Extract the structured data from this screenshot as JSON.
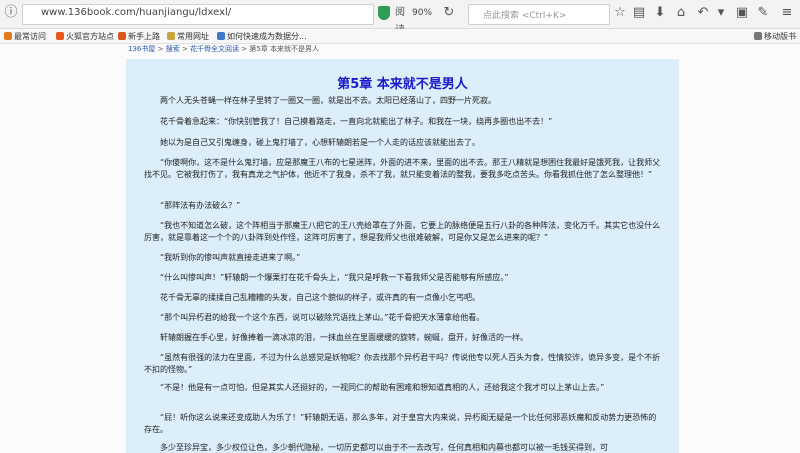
{
  "browser": {
    "url": "www.136book.com/huanjiangu/ldxexl/",
    "zoom": "90%",
    "search_placeholder": "点此搜索 <Ctrl+K>",
    "reader_label": "阅读"
  },
  "bookmarks": {
    "items": [
      "最常访问",
      "火狐官方站点",
      "新手上路",
      "常用网址",
      "如何快速成为数据分..."
    ],
    "mobile": "移动版书"
  },
  "breadcrumb": {
    "items": [
      "136书屋",
      "搜索",
      "花千骨全文阅读",
      "第5章 本来就不是男人"
    ]
  },
  "chapter": {
    "title": "第5章 本来就不是男人",
    "paragraphs": [
      "两个人无头苍蝇一样在林子里转了一圈又一圈，就是出不去。太阳已经落山了，四野一片死寂。",
      "花千骨着急起来：“你快别管我了！自己摸着路走，一直向北就能出了林子。和我在一块，绕再多圈也出不去！”",
      "她以为是自己又引鬼缠身，碰上鬼打墙了，心想轩辕朗若是一个人走的话应该就能出去了。",
      "“你傻啊你，这不是什么鬼打墙，应是那魔王八布的七星迷阵，外面的进不来，里面的出不去。那王八精就是想困住我最好是饿死我，让我师父找不见。它被我打伤了，我有真龙之气护体，他近不了我身，杀不了我，就只能变着法的整我，要我多吃点苦头。你看我抓住他了怎么整理他！”",
      "“那阵法有办法破么？”",
      "“我也不知道怎么破，这个阵相当于那魔王八把它的王八壳给罩在了外面，它要上的脉络便是五行八卦的各种阵法，变化万千。其实它也没什么厉害，就是靠着这一个个的八卦阵到处作怪，这阵可厉害了，想是我师父也很难破解，可是你又是怎么进来的呢？”",
      "“我听到你的惨叫声就直接走进来了啊。”",
      "“什么叫惨叫声！”轩辕朗一个爆栗打在花千骨头上，“我只是呼救一下看我师父是否能够有所感应。”",
      "花千骨无辜的揉揉自己乱糟糟的头发，自己这个貌似的样子，或许真的有一点像小乞丐吧。",
      "“那个叫异朽君的给我一个这个东西，说可以破除咒语找上茅山。”花千骨把天水薄拿给他看。",
      "轩辕朗握在手心里，好像捧着一滴冰凉的泪，一抹血丝在里面缓缓的旋转，蜿蜒，盘开，好像活的一样。",
      "“虽然有很强的法力在里面，不过为什么总感觉是妖物呢？你去找那个异朽君干吗？传说他专以死人百头为食，性情狡诈，诡异多变，是个不折不扣的怪物。”",
      "“不是！他是有一点可怕，但是其实人还挺好的，一视同仁的帮助有困难和想知道真相的人，还给我这个我才可以上茅山上去。”",
      "“屁！听你这么说来还变成助人为乐了！”轩辕朗无语，那么多年，对于皇宫大内来说，异朽阁无疑是一个比任何邪恶妖魔和反动势力更恐怖的存在。",
      "多少至珍异宝，多少权位让色，多少朝代隐秘，一切历史都可以由于不一去改写，任何真相和内幕也都可以被一毛钱买得到，可"
    ]
  }
}
